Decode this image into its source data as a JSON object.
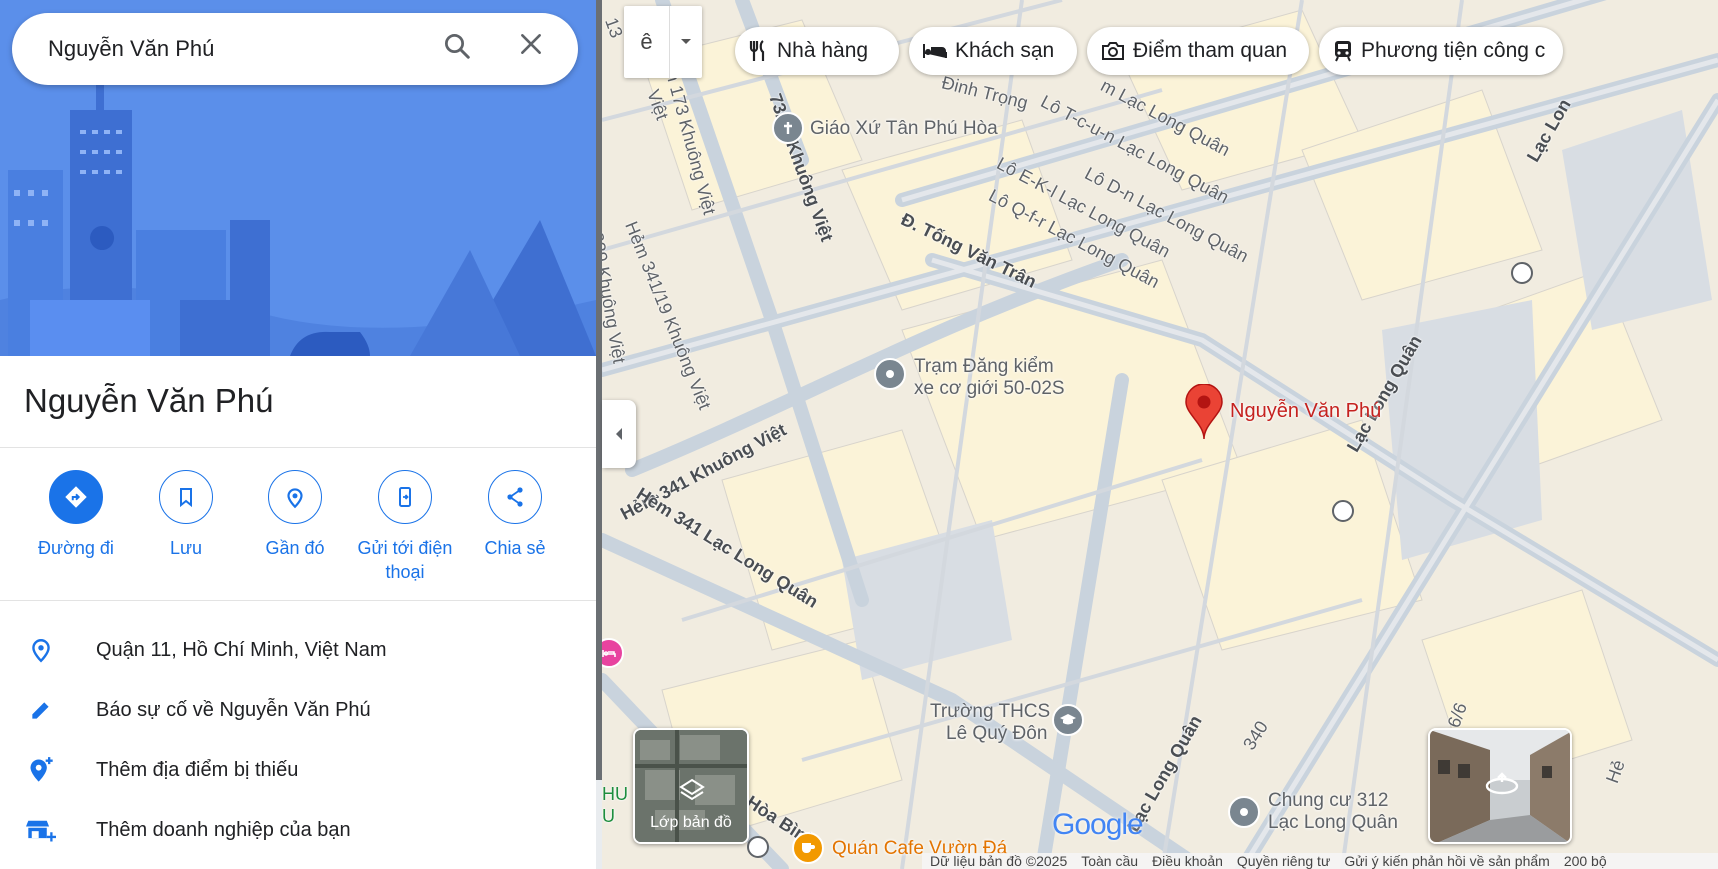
{
  "search": {
    "query": "Nguyễn Văn Phú"
  },
  "place": {
    "title": "Nguyễn Văn Phú"
  },
  "actions": [
    {
      "label": "Đường đi",
      "icon": "directions-icon"
    },
    {
      "label": "Lưu",
      "icon": "bookmark-icon"
    },
    {
      "label": "Gần đó",
      "icon": "nearby-icon"
    },
    {
      "label": "Gửi tới điện thoại",
      "icon": "send-to-phone-icon"
    },
    {
      "label": "Chia sẻ",
      "icon": "share-icon"
    }
  ],
  "info": [
    {
      "text": "Quận 11, Hồ Chí Minh, Việt Nam",
      "icon": "location-pin-icon"
    },
    {
      "text": "Báo sự cố về Nguyễn Văn Phú",
      "icon": "pencil-icon"
    },
    {
      "text": "Thêm địa điểm bị thiếu",
      "icon": "add-place-icon"
    },
    {
      "text": "Thêm doanh nghiệp của bạn",
      "icon": "add-business-icon"
    }
  ],
  "map": {
    "language_button": "ê",
    "chips": [
      {
        "label": "Nhà hàng",
        "icon": "restaurant-icon"
      },
      {
        "label": "Khách sạn",
        "icon": "hotel-icon"
      },
      {
        "label": "Điểm tham quan",
        "icon": "camera-icon"
      },
      {
        "label": "Phương tiện công c",
        "icon": "transit-icon"
      }
    ],
    "marker_label": "Nguyễn Văn Phú",
    "pois": {
      "church": "Giáo Xứ Tân Phú Hòa",
      "station_line1": "Trạm Đăng kiểm",
      "station_line2": "xe cơ giới 50-02S",
      "school_line1": "Trường THCS",
      "school_line2": "Lê Quý Đôn",
      "apartment_line1": "Chung cư 312",
      "apartment_line2": "Lạc Long Quân",
      "cafe": "Quán Cafe Vườn Đá"
    },
    "streets": {
      "tong_van_tran": "Đ. Tống Văn Trân",
      "hem_341_khuong_viet": "Hẻm 341 Khuông Việt",
      "hem_341_lac_long_quan": "Hẻm 341 Lạc Long Quân",
      "lac_long_quan_1": "Lạc Long Quân",
      "lac_long_quan_2": "Lạc Long Quân",
      "lac_long_quan_top": "Lạc Lon",
      "hem_173": "Hẻm 173 Khuông Việt",
      "h73_45": "73/45 Khuông Việt",
      "hem_341_19": "Hẻm 341/19 Khuông Việt",
      "h239": "239 Khuông Việt",
      "lo_m": "m Lạc Long Quân",
      "lo_tcun": "Lô T-c-u-n Lạc Long Quân",
      "lo_dn": "Lô D-n Lạc Long Quân",
      "lo_ekl": "Lô E-K-l Lạc Long Quân",
      "lo_qfr": "Lô Q-f-r Lạc Long Quân",
      "dinh_trong": "Đinh Trọng",
      "hoa_binh": "Hòa Bình",
      "n340": "340",
      "hem_16_6": "16/6",
      "viet_partial": "Việt",
      "hem_partial": "Hẻ",
      "hu_partial": "HU",
      "u_partial": "U",
      "num13": "13"
    },
    "layer_button": "Lớp bản đồ",
    "google_logo": "Google",
    "footer": {
      "map_data": "Dữ liệu bản đồ ©2025",
      "global": "Toàn cầu",
      "terms": "Điều khoản",
      "privacy": "Quyền riêng tư",
      "feedback": "Gửi ý kiến phản hồi về sản phẩm",
      "scale": "200 bộ"
    }
  },
  "colors": {
    "accent": "#1a73e8",
    "marker": "#ea4335",
    "hero": "#5b8fea"
  }
}
